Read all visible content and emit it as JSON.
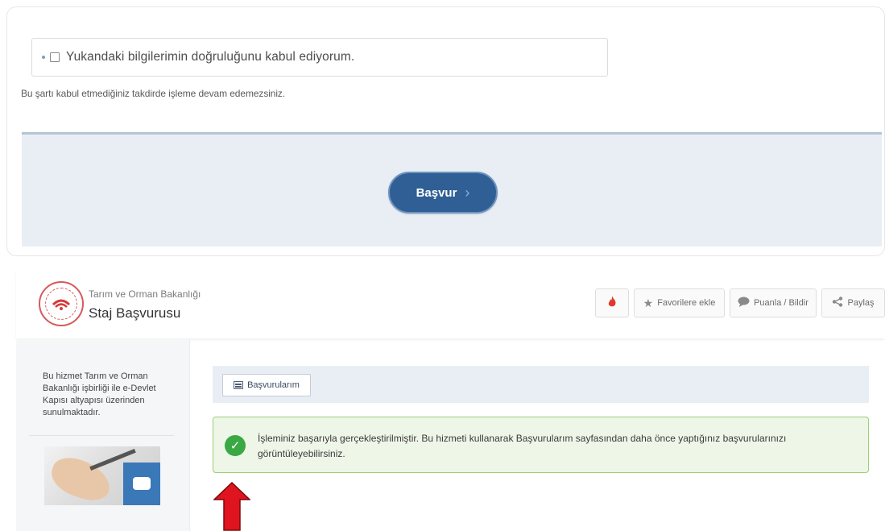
{
  "consent": {
    "checkbox_label": "Yukandaki bilgilerimin doğruluğunu kabul ediyorum.",
    "note": "Bu şartı kabul etmediğiniz takdirde işleme devam edemezsiniz.",
    "apply_label": "Başvur",
    "apply_chevron": "›"
  },
  "header": {
    "ministry": "Tarım ve Orman Bakanlığı",
    "service_title": "Staj Başvurusu",
    "hot_icon": "fire-icon",
    "favorites_label": "Favorilere ekle",
    "rate_label": "Puanla / Bildir",
    "share_label": "Paylaş"
  },
  "sidebar": {
    "info": "Bu hizmet Tarım ve Orman Bakanlığı işbirliği ile e-Devlet Kapısı altyapısı üzerinden sunulmaktadır."
  },
  "content": {
    "my_applications_label": "Başvurularım",
    "success_message": "İşleminiz başarıyla gerçekleştirilmiştir. Bu hizmeti kullanarak Başvurularım sayfasından daha önce yaptığınız başvurularınızı görüntüleyebilirsiniz."
  },
  "colors": {
    "brand_blue": "#2f5f95",
    "success_green": "#3aa843",
    "annotation_red": "#e0141e"
  }
}
